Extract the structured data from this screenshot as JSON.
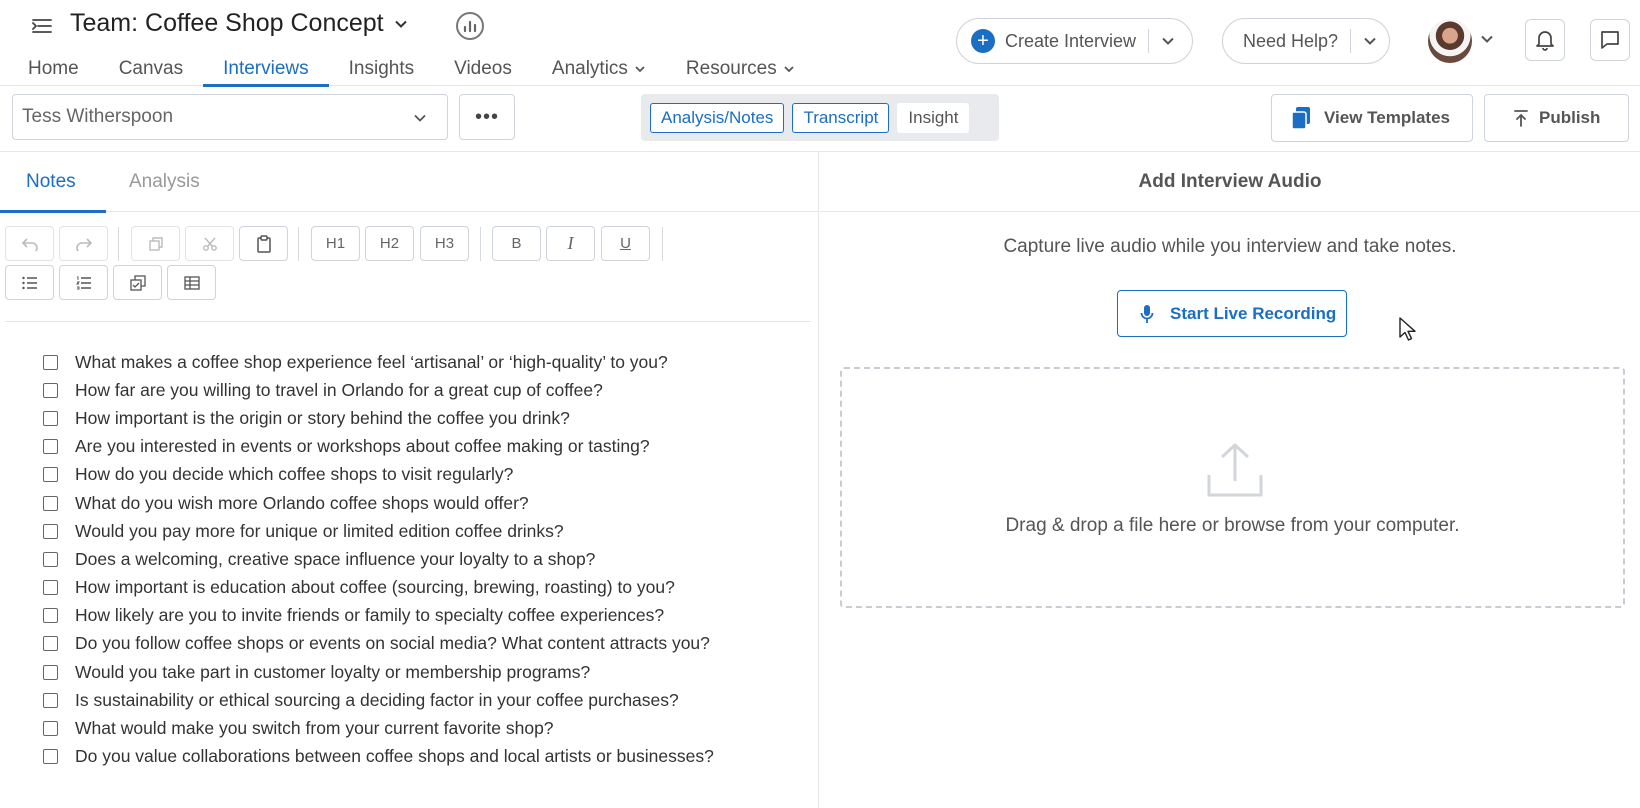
{
  "header": {
    "team_title": "Team: Coffee Shop Concept",
    "create_interview_label": "Create Interview",
    "need_help_label": "Need Help?"
  },
  "nav": {
    "items": [
      {
        "label": "Home"
      },
      {
        "label": "Canvas"
      },
      {
        "label": "Interviews"
      },
      {
        "label": "Insights"
      },
      {
        "label": "Videos"
      },
      {
        "label": "Analytics"
      },
      {
        "label": "Resources"
      }
    ],
    "active": "Interviews"
  },
  "subbar": {
    "interviewee": "Tess Witherspoon",
    "more_label": "•••",
    "view_toggle": [
      "Analysis/Notes",
      "Transcript",
      "Insight"
    ],
    "view_templates_label": "View Templates",
    "publish_label": "Publish"
  },
  "left_pane": {
    "tabs": [
      "Notes",
      "Analysis"
    ],
    "active_tab": "Notes",
    "toolbar": {
      "h1": "H1",
      "h2": "H2",
      "h3": "H3",
      "bold": "B",
      "italic": "I",
      "underline": "U"
    },
    "questions": [
      "What makes a coffee shop experience feel ‘artisanal’ or ‘high-quality’ to you?",
      "How far are you willing to travel in Orlando for a great cup of coffee?",
      "How important is the origin or story behind the coffee you drink?",
      "Are you interested in events or workshops about coffee making or tasting?",
      "How do you decide which coffee shops to visit regularly?",
      "What do you wish more Orlando coffee shops would offer?",
      "Would you pay more for unique or limited edition coffee drinks?",
      "Does a welcoming, creative space influence your loyalty to a shop?",
      "How important is education about coffee (sourcing, brewing, roasting) to you?",
      "How likely are you to invite friends or family to specialty coffee experiences?",
      "Do you follow coffee shops or events on social media? What content attracts you?",
      "Would you take part in customer loyalty or membership programs?",
      "Is sustainability or ethical sourcing a deciding factor in your coffee purchases?",
      "What would make you switch from your current favorite shop?",
      "Do you value collaborations between coffee shops and local artists or businesses?"
    ]
  },
  "right_pane": {
    "title": "Add Interview Audio",
    "capture_text": "Capture live audio while you interview and take notes.",
    "record_label": "Start Live Recording",
    "drop_text": "Drag & drop a file here or browse from your computer."
  },
  "colors": {
    "accent": "#1b6ec2",
    "border": "#cfd4da",
    "muted_text": "#555555"
  }
}
